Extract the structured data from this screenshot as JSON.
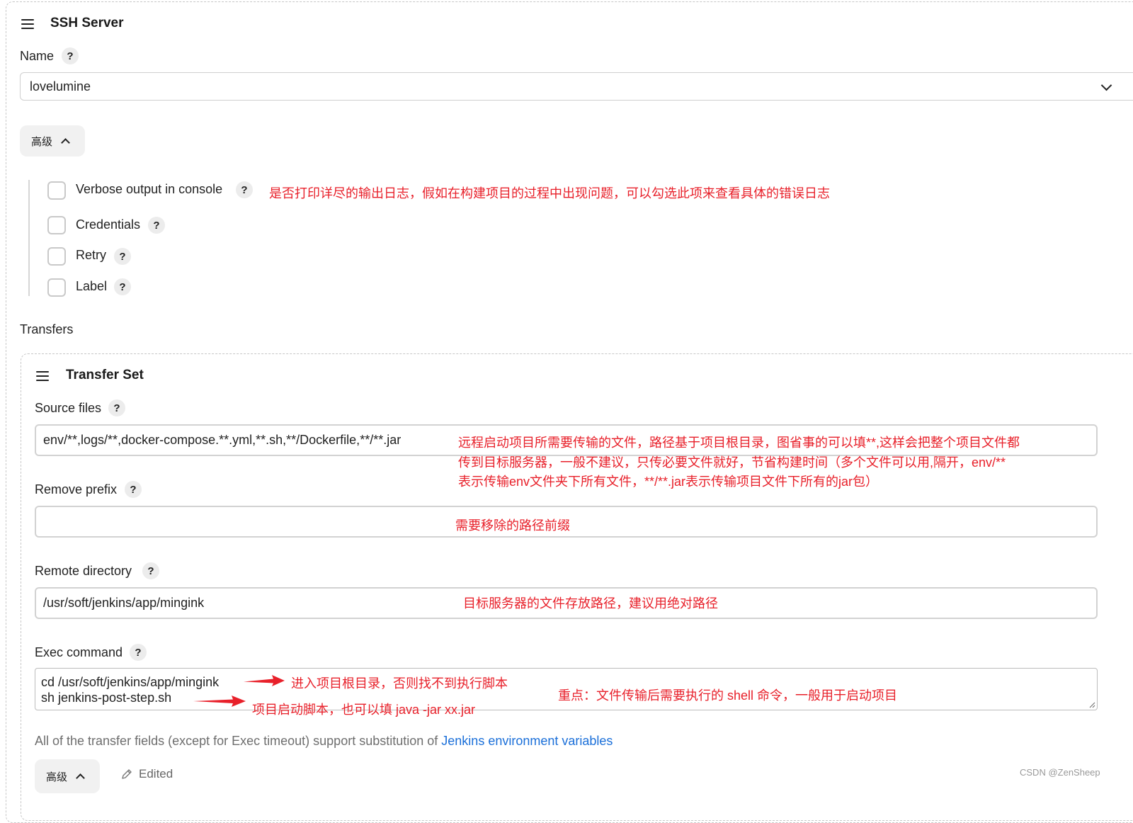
{
  "ssh_server": {
    "title": "SSH Server",
    "name_label": "Name",
    "name_value": "lovelumine",
    "advanced_label": "高级",
    "options": [
      {
        "label": "Verbose output in console",
        "checked": false
      },
      {
        "label": "Credentials",
        "checked": false
      },
      {
        "label": "Retry",
        "checked": false
      },
      {
        "label": "Label",
        "checked": false
      }
    ],
    "verbose_annotation": "是否打印详尽的输出日志，假如在构建项目的过程中出现问题，可以勾选此项来查看具体的错误日志",
    "transfers_label": "Transfers"
  },
  "transfer_set": {
    "title": "Transfer Set",
    "source_files_label": "Source files",
    "source_files_value": "env/**,logs/**,docker-compose.**.yml,**.sh,**/Dockerfile,**/**.jar",
    "source_annotation": [
      "远程启动项目所需要传输的文件，路径基于项目根目录，图省事的可以填**,这样会把整个项目文件都",
      "传到目标服务器，一般不建议，只传必要文件就好，节省构建时间（多个文件可以用,隔开，env/**",
      "表示传输env文件夹下所有文件，**/**.jar表示传输项目文件下所有的jar包）"
    ],
    "remove_prefix_label": "Remove prefix",
    "remove_prefix_value": "",
    "remove_prefix_annotation": "需要移除的路径前缀",
    "remote_directory_label": "Remote directory",
    "remote_directory_value": "/usr/soft/jenkins/app/mingink",
    "remote_directory_annotation": "目标服务器的文件存放路径，建议用绝对路径",
    "exec_command_label": "Exec command",
    "exec_command_lines": [
      "cd /usr/soft/jenkins/app/mingink",
      "sh jenkins-post-step.sh"
    ],
    "exec_line1_annotation": "进入项目根目录，否则找不到执行脚本",
    "exec_line2_annotation": "项目启动脚本，也可以填 java -jar xx.jar",
    "exec_command_annotation": "重点：文件传输后需要执行的 shell 命令，一般用于启动项目",
    "footnote_text": "All of the transfer fields (except for Exec timeout) support substitution of ",
    "footnote_link": "Jenkins environment variables",
    "advanced_label": "高级",
    "edited_label": "Edited"
  },
  "help_glyph": "?",
  "watermark": "CSDN @ZenSheep",
  "colors": {
    "annotation": "#e8202a",
    "link": "#1a6fd9",
    "border": "#d2d2d2"
  },
  "icons": [
    "drag-handle-icon",
    "help-icon",
    "chevron-down-icon",
    "chevron-up-icon",
    "pencil-icon",
    "arrow-right-icon"
  ]
}
